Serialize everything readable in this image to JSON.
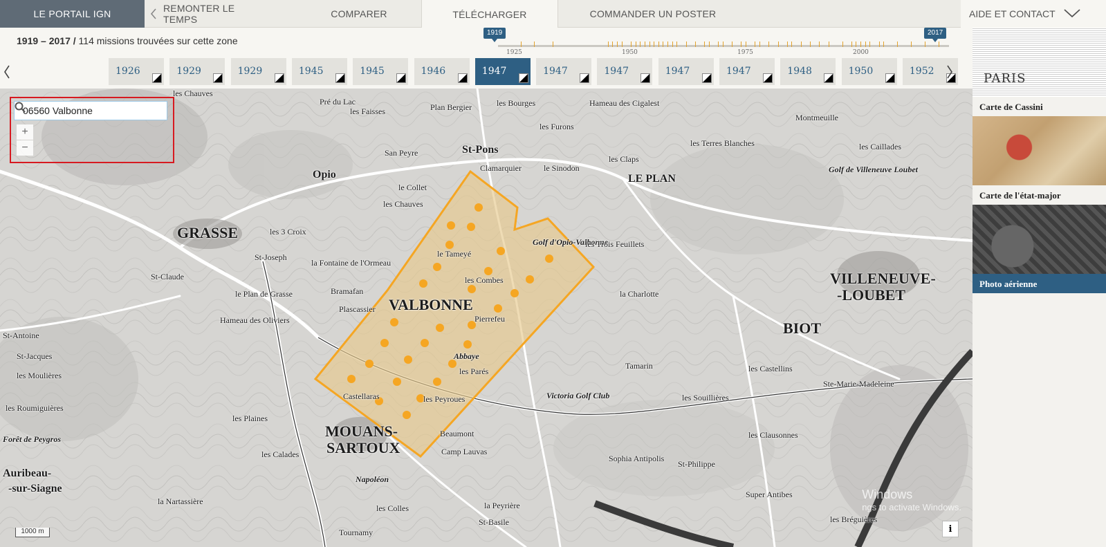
{
  "nav": {
    "brand": "LE PORTAIL IGN",
    "tabs": [
      {
        "label": "REMONTER LE TEMPS"
      },
      {
        "label": "COMPARER"
      },
      {
        "label": "TÉLÉCHARGER"
      },
      {
        "label": "COMMANDER UN POSTER"
      }
    ],
    "help": "AIDE ET CONTACT",
    "active_tab": "TÉLÉCHARGER"
  },
  "missions": {
    "range": "1919 – 2017 /",
    "count_text": "114 missions trouvées sur cette zone"
  },
  "timeline": {
    "start_badge": "1919",
    "end_badge": "2017",
    "labels": [
      "1925",
      "1950",
      "1975",
      "2000"
    ],
    "start_year": 1919,
    "end_year": 2017,
    "marked_years": [
      1926,
      1929,
      1933,
      1945,
      1946,
      1947,
      1948,
      1950,
      1951,
      1952,
      1953,
      1954,
      1955,
      1956,
      1957,
      1958,
      1959,
      1960,
      1962,
      1964,
      1966,
      1967,
      1969,
      1970,
      1972,
      1974,
      1975,
      1977,
      1978,
      1980,
      1982,
      1984,
      1985,
      1987,
      1989,
      1991,
      1993,
      1996,
      1998,
      1999,
      2000,
      2001,
      2002,
      2004,
      2005,
      2008,
      2011,
      2014,
      2017
    ]
  },
  "years": [
    {
      "label": "1926",
      "active": false
    },
    {
      "label": "1929",
      "active": false
    },
    {
      "label": "1929",
      "active": false
    },
    {
      "label": "1945",
      "active": false
    },
    {
      "label": "1945",
      "active": false
    },
    {
      "label": "1946",
      "active": false
    },
    {
      "label": "1947",
      "active": true
    },
    {
      "label": "1947",
      "active": false
    },
    {
      "label": "1947",
      "active": false
    },
    {
      "label": "1947",
      "active": false
    },
    {
      "label": "1947",
      "active": false
    },
    {
      "label": "1948",
      "active": false
    },
    {
      "label": "1950",
      "active": false
    },
    {
      "label": "1952",
      "active": false
    }
  ],
  "search": {
    "value": "06560 Valbonne"
  },
  "zoom": {
    "in": "+",
    "out": "−"
  },
  "map": {
    "scale": "1000 m",
    "info": "i",
    "watermark_title": "Windows",
    "watermark_text": "ngs to activate Windows.",
    "labels": [
      {
        "text": "GRASSE",
        "cls": "ml-big"
      },
      {
        "text": "VALBONNE",
        "cls": "ml-big"
      },
      {
        "text": "LE PLAN",
        "cls": "ml-med"
      },
      {
        "text": "Opio",
        "cls": "ml-med"
      },
      {
        "text": "St-Pons",
        "cls": "ml-med"
      },
      {
        "text": "VILLENEUVE-",
        "cls": "ml-big"
      },
      {
        "text": "-LOUBET",
        "cls": "ml-big"
      },
      {
        "text": "BIOT",
        "cls": "ml-big"
      },
      {
        "text": "MOUANS-",
        "cls": "ml-big"
      },
      {
        "text": "SARTOUX",
        "cls": "ml-big"
      },
      {
        "text": "Auribeau-",
        "cls": "ml-med"
      },
      {
        "text": "-sur-Siagne",
        "cls": "ml-med"
      },
      {
        "text": "les Chauves",
        "cls": "ml-sm"
      },
      {
        "text": "Pré du Lac",
        "cls": "ml-sm"
      },
      {
        "text": "les Faisses",
        "cls": "ml-sm"
      },
      {
        "text": "Plan Bergier",
        "cls": "ml-sm"
      },
      {
        "text": "les Bourges",
        "cls": "ml-sm"
      },
      {
        "text": "Clamarquier",
        "cls": "ml-sm"
      },
      {
        "text": "le Sinodon",
        "cls": "ml-sm"
      },
      {
        "text": "le Tameyé",
        "cls": "ml-sm"
      },
      {
        "text": "les Combes",
        "cls": "ml-sm"
      },
      {
        "text": "Pierrefeu",
        "cls": "ml-sm"
      },
      {
        "text": "Abbaye",
        "cls": "ml-it"
      },
      {
        "text": "les Parés",
        "cls": "ml-sm"
      },
      {
        "text": "les Peyroues",
        "cls": "ml-sm"
      },
      {
        "text": "Castellaras",
        "cls": "ml-sm"
      },
      {
        "text": "Beaumont",
        "cls": "ml-sm"
      },
      {
        "text": "Camp Lauvas",
        "cls": "ml-sm"
      },
      {
        "text": "St-Antoine",
        "cls": "ml-sm"
      },
      {
        "text": "St-Claude",
        "cls": "ml-sm"
      },
      {
        "text": "St-Jacques",
        "cls": "ml-sm"
      },
      {
        "text": "les Moulières",
        "cls": "ml-sm"
      },
      {
        "text": "les Roumiguières",
        "cls": "ml-sm"
      },
      {
        "text": "Forêt de Peygros",
        "cls": "ml-it"
      },
      {
        "text": "Golf d'Opio-Valbonne",
        "cls": "ml-it"
      },
      {
        "text": "Golf de Villeneuve Loubet",
        "cls": "ml-it"
      },
      {
        "text": "Victoria Golf Club",
        "cls": "ml-it"
      },
      {
        "text": "les Trois Feuillets",
        "cls": "ml-sm"
      },
      {
        "text": "la Charlotte",
        "cls": "ml-sm"
      },
      {
        "text": "les Castellins",
        "cls": "ml-sm"
      },
      {
        "text": "Ste-Marie-Madeleine",
        "cls": "ml-sm"
      },
      {
        "text": "les Clausonnes",
        "cls": "ml-sm"
      },
      {
        "text": "Sophia Antipolis",
        "cls": "ml-sm"
      },
      {
        "text": "St-Philippe",
        "cls": "ml-sm"
      },
      {
        "text": "les Souillières",
        "cls": "ml-sm"
      },
      {
        "text": "Tamarin",
        "cls": "ml-sm"
      },
      {
        "text": "la Peyrière",
        "cls": "ml-sm"
      },
      {
        "text": "St-Basile",
        "cls": "ml-sm"
      },
      {
        "text": "Super Antibes",
        "cls": "ml-sm"
      },
      {
        "text": "les Bréguières",
        "cls": "ml-sm"
      },
      {
        "text": "Tournamy",
        "cls": "ml-sm"
      },
      {
        "text": "les Colles",
        "cls": "ml-sm"
      },
      {
        "text": "Napoléon",
        "cls": "ml-it"
      },
      {
        "text": "la Nartassière",
        "cls": "ml-sm"
      },
      {
        "text": "les Calades",
        "cls": "ml-sm"
      },
      {
        "text": "les Plaines",
        "cls": "ml-sm"
      },
      {
        "text": "Hameau des Oliviers",
        "cls": "ml-sm"
      },
      {
        "text": "le Plan de Grasse",
        "cls": "ml-sm"
      },
      {
        "text": "Plascassier",
        "cls": "ml-sm"
      },
      {
        "text": "Bramafan",
        "cls": "ml-sm"
      },
      {
        "text": "la Fontaine de l'Ormeau",
        "cls": "ml-sm"
      },
      {
        "text": "St-Joseph",
        "cls": "ml-sm"
      },
      {
        "text": "les 3 Croix",
        "cls": "ml-sm"
      },
      {
        "text": "les Chauves",
        "cls": "ml-sm"
      },
      {
        "text": "le Collet",
        "cls": "ml-sm"
      },
      {
        "text": "San Peyre",
        "cls": "ml-sm"
      },
      {
        "text": "Montmeuille",
        "cls": "ml-sm"
      },
      {
        "text": "les Caillades",
        "cls": "ml-sm"
      },
      {
        "text": "les Terres Blanches",
        "cls": "ml-sm"
      },
      {
        "text": "les Claps",
        "cls": "ml-sm"
      },
      {
        "text": "les Furons",
        "cls": "ml-sm"
      },
      {
        "text": "Hameau des Cigalest",
        "cls": "ml-sm"
      }
    ]
  },
  "layers": [
    {
      "label": "Carte de Cassini",
      "thumb_text": "PARIS",
      "active": false
    },
    {
      "label": "Carte de l'état-major",
      "active": false
    },
    {
      "label": "Photo aérienne",
      "active": true
    }
  ],
  "colors": {
    "accent": "#2e5f83",
    "brand_bg": "#5f6b76",
    "selection": "#f5a623",
    "highlight_border": "#d71920"
  }
}
